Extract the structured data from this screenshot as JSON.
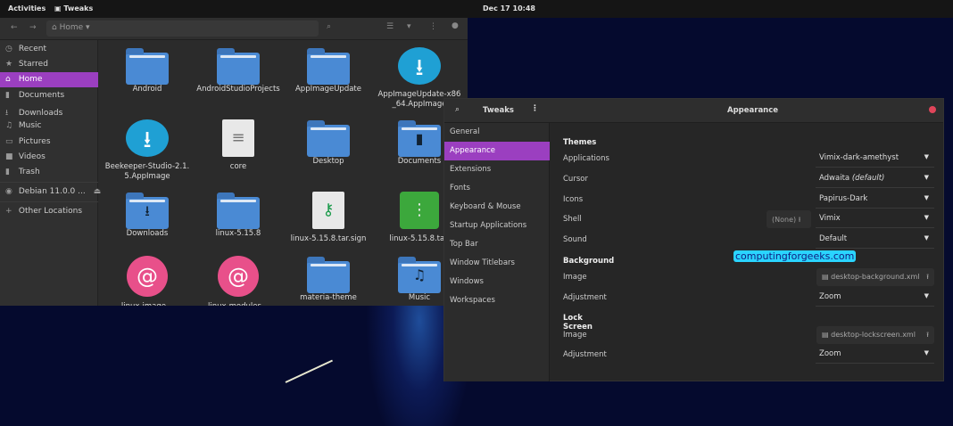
{
  "topbar": {
    "activities": "Activities",
    "app": "Tweaks",
    "clock": "Dec 17  10:48"
  },
  "files": {
    "path": "Home",
    "sidebar": [
      {
        "label": "Recent",
        "icon": "clock-icon"
      },
      {
        "label": "Starred",
        "icon": "star-icon"
      },
      {
        "label": "Home",
        "icon": "home-icon",
        "selected": true
      },
      {
        "label": "Documents",
        "icon": "document-icon"
      },
      {
        "label": "Downloads",
        "icon": "download-icon"
      },
      {
        "label": "Music",
        "icon": "music-icon"
      },
      {
        "label": "Pictures",
        "icon": "picture-icon"
      },
      {
        "label": "Videos",
        "icon": "video-icon"
      },
      {
        "label": "Trash",
        "icon": "trash-icon"
      },
      {
        "label": "Debian 11.0.0 ...",
        "icon": "disc-icon"
      },
      {
        "label": "Other Locations",
        "icon": "plus-icon"
      }
    ],
    "items": [
      {
        "name": "Android",
        "type": "folder"
      },
      {
        "name": "AndroidStudioProjects",
        "type": "folder"
      },
      {
        "name": "AppImageUpdate",
        "type": "folder"
      },
      {
        "name": "AppImageUpdate-x86_64.AppImage",
        "type": "appimage"
      },
      {
        "name": "Beekeeper-Studio-2.1.5.AppImage",
        "type": "appimage"
      },
      {
        "name": "core",
        "type": "text"
      },
      {
        "name": "Desktop",
        "type": "folder"
      },
      {
        "name": "Documents",
        "type": "folder-documents"
      },
      {
        "name": "Downloads",
        "type": "folder-downloads"
      },
      {
        "name": "linux-5.15.8",
        "type": "folder"
      },
      {
        "name": "linux-5.15.8.tar.sign",
        "type": "key"
      },
      {
        "name": "linux-5.15.8.tar.",
        "type": "archive"
      },
      {
        "name": "linux-image...",
        "type": "debian"
      },
      {
        "name": "linux-modules...",
        "type": "debian"
      },
      {
        "name": "materia-theme",
        "type": "folder"
      },
      {
        "name": "Music",
        "type": "folder-music"
      }
    ]
  },
  "tweaks": {
    "title": "Tweaks",
    "page_title": "Appearance",
    "sidebar": [
      "General",
      "Appearance",
      "Extensions",
      "Fonts",
      "Keyboard & Mouse",
      "Startup Applications",
      "Top Bar",
      "Window Titlebars",
      "Windows",
      "Workspaces"
    ],
    "selected": "Appearance",
    "themes": {
      "heading": "Themes",
      "applications": {
        "label": "Applications",
        "value": "Vimix-dark-amethyst"
      },
      "cursor": {
        "label": "Cursor",
        "value": "Adwaita",
        "suffix": "(default)"
      },
      "icons": {
        "label": "Icons",
        "value": "Papirus-Dark"
      },
      "shell": {
        "label": "Shell",
        "none": "(None)",
        "value": "Vimix"
      },
      "sound": {
        "label": "Sound",
        "value": "Default"
      }
    },
    "background": {
      "heading": "Background",
      "image": {
        "label": "Image",
        "value": "desktop-background.xml"
      },
      "adjustment": {
        "label": "Adjustment",
        "value": "Zoom"
      }
    },
    "lockscreen": {
      "heading": "Lock Screen",
      "image": {
        "label": "Image",
        "value": "desktop-lockscreen.xml"
      },
      "adjustment": {
        "label": "Adjustment",
        "value": "Zoom"
      }
    },
    "accent": "#9b3fc0"
  },
  "watermark": "computingforgeeks.com"
}
